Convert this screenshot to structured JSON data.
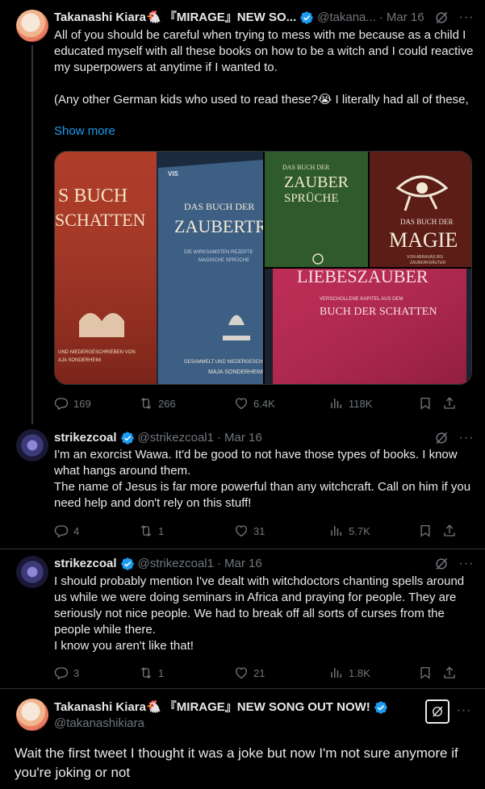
{
  "tweet1": {
    "name": "Takanashi Kiara🐔 『MIRAGE』NEW SO...",
    "handle": "@takana...",
    "date": "Mar 16",
    "text": "All of you should be careful when trying to mess with me because as a child I educated myself with all these books on how to be a witch and I could reactive my superpowers at anytime if I wanted to.\n\n(Any other German kids who used to read these?😭 I literally had all of these,",
    "show_more": "Show more",
    "images": {
      "book1_title_a": "S BUCH",
      "book1_title_b": "SCHATTEN",
      "book1_bottom_a": "UND NIEDERGESCHRIEBEN VON",
      "book1_bottom_b": "AJA SONDERHEIM",
      "book2_publisher": "VIS",
      "book2_title_a": "DAS BUCH DER",
      "book2_title_b": "ZAUBERTRÄ",
      "book2_sub_a": "DIE WIRKSAMSTEN REZEPTE",
      "book2_sub_b": "MAGISCHE SPRÜCHE",
      "book2_bottom_a": "GESAMMELT UND NIEDERGESCH",
      "book2_bottom_b": "MAJA SONDERHEIM",
      "book3_title_a": "DAS BUCH DER",
      "book3_title_b": "ZAUBER",
      "book3_title_c": "SPRÜCHE",
      "book4_title_a": "DAS BUCH DER",
      "book4_title_b": "MAGIE",
      "book4_sub_a": "VON ABRAXAS BIS",
      "book4_sub_b": "ZAUBERKRÄUTER",
      "book5_title": "LIEBESZAUBER",
      "book5_sub": "VERSCHOLLENE KAPITEL AUS DEM",
      "book5_bottom": "BUCH DER SCHATTEN"
    },
    "replies": "169",
    "reposts": "266",
    "likes": "6.4K",
    "views": "118K"
  },
  "tweet2": {
    "name": "strikezcoal",
    "handle": "@strikezcoal1",
    "date": "Mar 16",
    "text": "I'm an exorcist Wawa. It'd be good to not have those types of books. I know what hangs around them.\nThe name of Jesus is far more powerful than any witchcraft. Call on him if you need help and don't rely on this stuff!",
    "replies": "4",
    "reposts": "1",
    "likes": "31",
    "views": "5.7K"
  },
  "tweet3": {
    "name": "strikezcoal",
    "handle": "@strikezcoal1",
    "date": "Mar 16",
    "text": "I should probably mention I've dealt with witchdoctors chanting spells around us while we were doing seminars in Africa and praying for people. They are seriously not nice people. We had to break off all sorts of curses from the people while there.\nI know you aren't like that!",
    "replies": "3",
    "reposts": "1",
    "likes": "21",
    "views": "1.8K"
  },
  "tweet4": {
    "name": "Takanashi Kiara🐔 『MIRAGE』NEW SONG OUT NOW!",
    "handle": "@takanashikiara",
    "text": "Wait the first tweet I thought it was a joke but now I'm not sure anymore if you're joking or not"
  },
  "colors": {
    "background": "#000000",
    "text": "#e7e9ea",
    "muted": "#71767b",
    "link": "#1d9bf0",
    "verified": "#1d9bf0"
  },
  "icons": [
    "reply-icon",
    "repost-icon",
    "like-icon",
    "views-icon",
    "bookmark-icon",
    "share-icon",
    "grok-icon",
    "more-icon",
    "verified-icon"
  ]
}
